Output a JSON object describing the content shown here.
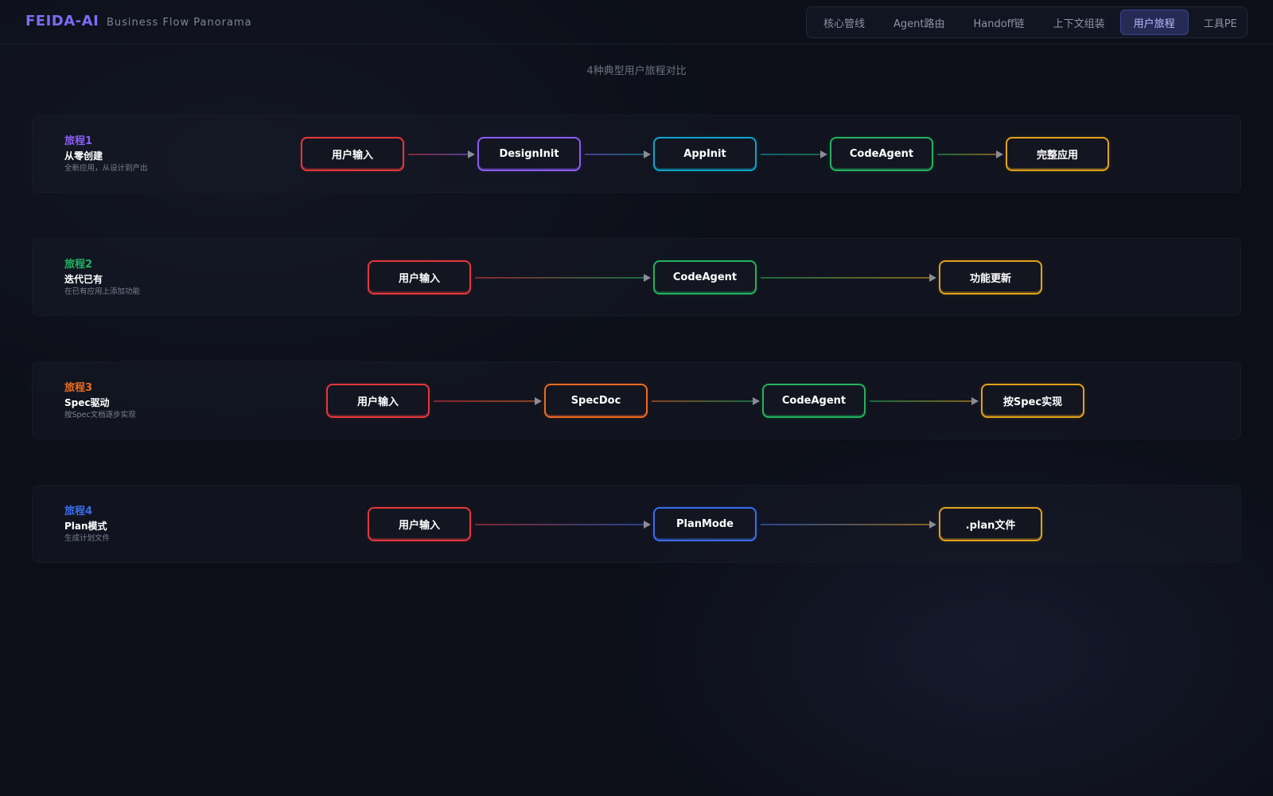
{
  "header": {
    "brand": "FEIDA-AI",
    "subtitle": "Business Flow Panorama",
    "tabs": [
      {
        "label": "核心管线",
        "active": false
      },
      {
        "label": "Agent路由",
        "active": false
      },
      {
        "label": "Handoff链",
        "active": false
      },
      {
        "label": "上下文组装",
        "active": false
      },
      {
        "label": "用户旅程",
        "active": true
      },
      {
        "label": "工具PE",
        "active": false
      }
    ]
  },
  "page": {
    "subtitle": "4种典型用户旅程对比"
  },
  "colors": {
    "accent": "#7c6cf2",
    "red": "#e5383b",
    "purple": "#8b5cf6",
    "cyan": "#0ea5c9",
    "green": "#22b35e",
    "amber": "#e0a21a",
    "orange": "#ee6a1f",
    "blue": "#3b6cf0"
  },
  "journeys": [
    {
      "title": "旅程1",
      "name": "从零创建",
      "desc": "全新应用，从设计到产出",
      "title_color": "#8b5cf6",
      "nodes": [
        {
          "label": "用户输入",
          "color": "#e5383b"
        },
        {
          "label": "DesignInit",
          "color": "#8b5cf6"
        },
        {
          "label": "AppInit",
          "color": "#0ea5c9"
        },
        {
          "label": "CodeAgent",
          "color": "#22b35e"
        },
        {
          "label": "完整应用",
          "color": "#e0a21a"
        }
      ]
    },
    {
      "title": "旅程2",
      "name": "迭代已有",
      "desc": "在已有应用上添加功能",
      "title_color": "#22b35e",
      "nodes": [
        {
          "label": "用户输入",
          "color": "#e5383b"
        },
        {
          "label": "CodeAgent",
          "color": "#22b35e"
        },
        {
          "label": "功能更新",
          "color": "#e0a21a"
        }
      ]
    },
    {
      "title": "旅程3",
      "name": "Spec驱动",
      "desc": "按Spec文档逐步实现",
      "title_color": "#ee6a1f",
      "nodes": [
        {
          "label": "用户输入",
          "color": "#e5383b"
        },
        {
          "label": "SpecDoc",
          "color": "#ee6a1f"
        },
        {
          "label": "CodeAgent",
          "color": "#22b35e"
        },
        {
          "label": "按Spec实现",
          "color": "#e0a21a"
        }
      ]
    },
    {
      "title": "旅程4",
      "name": "Plan模式",
      "desc": "生成计划文件",
      "title_color": "#3b6cf0",
      "nodes": [
        {
          "label": "用户输入",
          "color": "#e5383b"
        },
        {
          "label": "PlanMode",
          "color": "#3b6cf0"
        },
        {
          "label": ".plan文件",
          "color": "#e0a21a"
        }
      ]
    }
  ]
}
